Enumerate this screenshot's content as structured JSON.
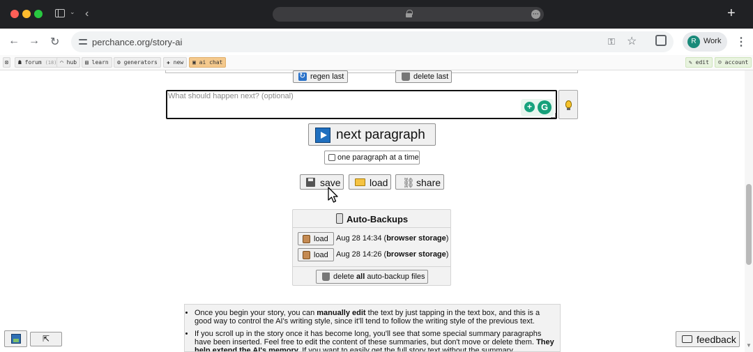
{
  "browser": {
    "url": "perchance.org/story-ai",
    "profile_initial": "R",
    "profile_label": "Work",
    "bookmarks": [
      {
        "label": "forum",
        "badge": "(18)"
      },
      {
        "label": "hub"
      },
      {
        "label": "learn"
      },
      {
        "label": "generators"
      },
      {
        "label": "new"
      },
      {
        "label": "ai chat"
      }
    ],
    "right_links": [
      {
        "label": "edit"
      },
      {
        "label": "account"
      }
    ]
  },
  "controls": {
    "regen_label": "regen last",
    "delete_last_label": "delete last",
    "next_placeholder": "What should happen next? (optional)",
    "next_paragraph_label": "next paragraph",
    "one_paragraph_label": "one paragraph at a time",
    "save_label": "save",
    "load_label": "load",
    "share_label": "share"
  },
  "backups": {
    "title": "Auto-Backups",
    "load_label": "load",
    "items": [
      {
        "time": "Aug 28 14:34",
        "storage": "browser storage"
      },
      {
        "time": "Aug 28 14:26",
        "storage": "browser storage"
      }
    ],
    "delete_all_prefix": "delete",
    "delete_all_bold": "all",
    "delete_all_suffix": "auto-backup files"
  },
  "tips": {
    "t1_a": "Once you begin your story, you can ",
    "t1_b": "manually edit",
    "t1_c": " the text by just tapping in the text box, and this is a good way to control the AI's writing style, since it'll tend to follow the writing style of the previous text.",
    "t2_a": "If you scroll up in the story once it has become long, you'll see that some special summary paragraphs have been inserted. Feel free to edit the content of these summaries, but don't move or delete them. ",
    "t2_b": "They help extend the AI's memory.",
    "t2_c": " If you want to easily get the full story text without the summary paragraphs, you"
  },
  "footer": {
    "expand_glyph": "⇱",
    "feedback_label": "feedback"
  }
}
